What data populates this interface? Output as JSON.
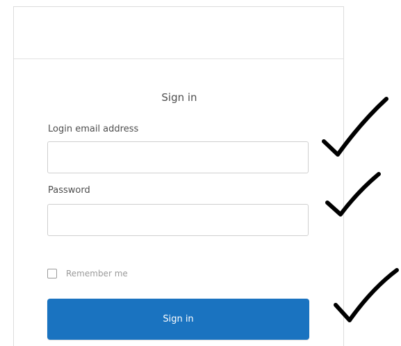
{
  "signin_form": {
    "title": "Sign in",
    "email_label": "Login email address",
    "email_value": "",
    "password_label": "Password",
    "password_value": "",
    "remember_label": "Remember me",
    "remember_checked": false,
    "submit_label": "Sign in"
  },
  "annotations": {
    "check_marks": [
      "email-check",
      "password-check",
      "signin-check"
    ],
    "mark_color": "#000000"
  },
  "colors": {
    "primary_button": "#1a73c0",
    "border": "#cfcfcf",
    "text": "#4d4d4d",
    "muted_text": "#9a9a9a"
  }
}
